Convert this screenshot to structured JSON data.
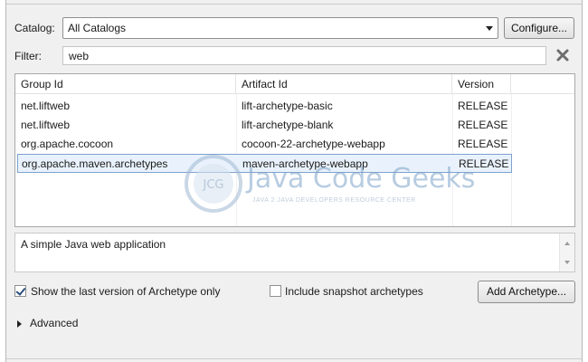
{
  "catalog": {
    "label": "Catalog:",
    "value": "All Catalogs",
    "configure_label": "Configure..."
  },
  "filter": {
    "label": "Filter:",
    "value": "web"
  },
  "table": {
    "columns": [
      "Group Id",
      "Artifact Id",
      "Version"
    ],
    "rows": [
      {
        "group": "net.liftweb",
        "artifact": "lift-archetype-basic",
        "version": "RELEASE"
      },
      {
        "group": "net.liftweb",
        "artifact": "lift-archetype-blank",
        "version": "RELEASE"
      },
      {
        "group": "org.apache.cocoon",
        "artifact": "cocoon-22-archetype-webapp",
        "version": "RELEASE"
      },
      {
        "group": "org.apache.maven.archetypes",
        "artifact": "maven-archetype-webapp",
        "version": "RELEASE"
      }
    ],
    "selected_row": 3
  },
  "watermark": {
    "badge": "JCG",
    "title": "Java Code Geeks",
    "subtitle": "JAVA 2 JAVA DEVELOPERS RESOURCE CENTER"
  },
  "description": "A simple Java web application",
  "options": {
    "show_last_version_label": "Show the last version of Archetype only",
    "show_last_version_checked": true,
    "include_snapshot_label": "Include snapshot archetypes",
    "include_snapshot_checked": false,
    "add_archetype_label": "Add Archetype..."
  },
  "advanced_label": "Advanced",
  "colors": {
    "selection_bg": "#e9f2fc",
    "selection_border": "#7da2ce",
    "panel_bg": "#f0f0f0"
  }
}
